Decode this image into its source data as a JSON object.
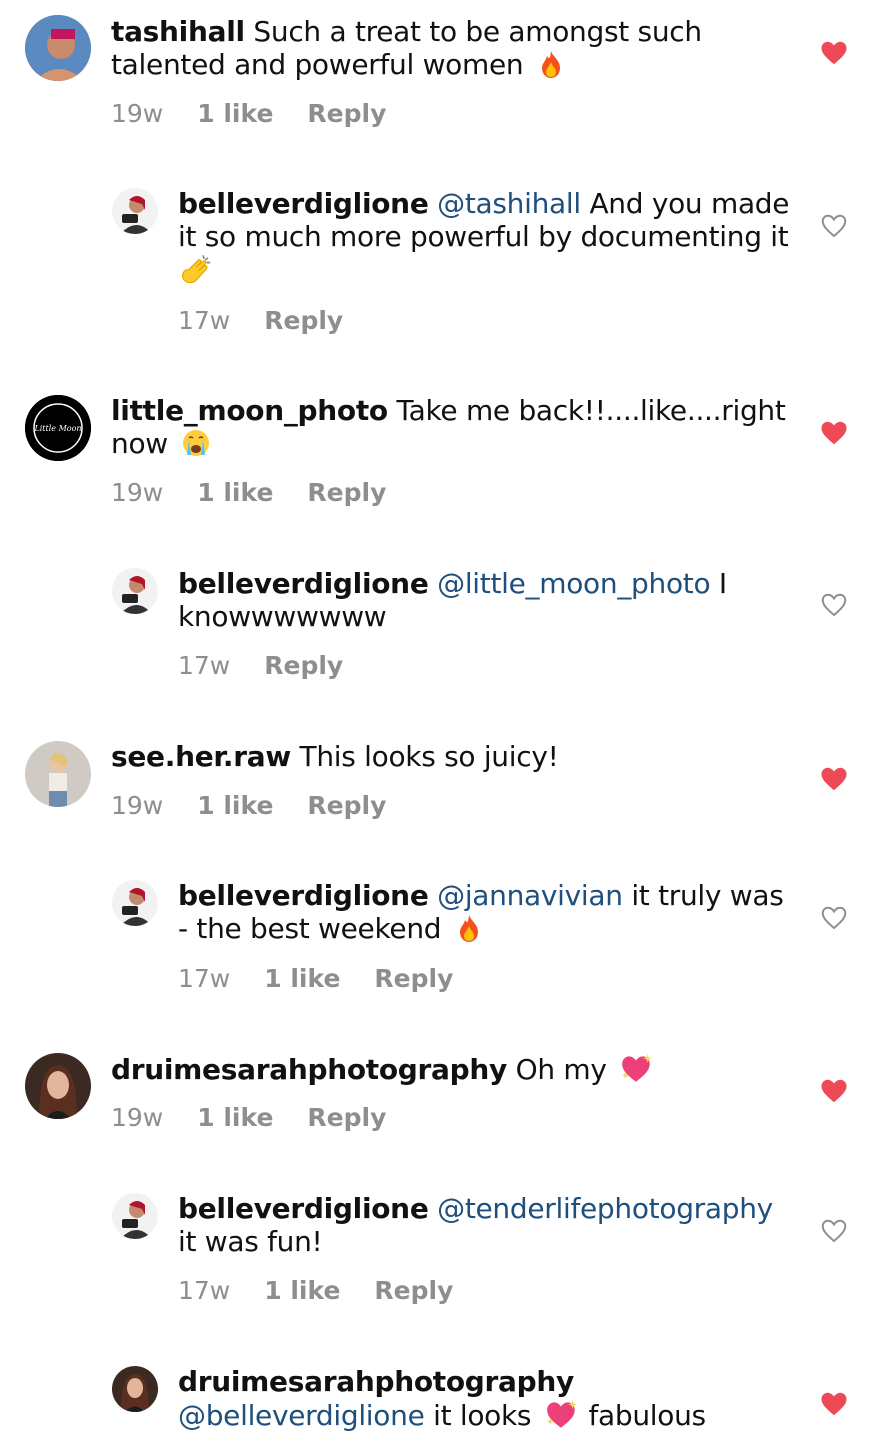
{
  "comments": [
    {
      "user": "tashihall",
      "text": "Such a treat to be amongst such talented and powerful women",
      "emoji": "fire-emoji",
      "age": "19w",
      "likes": "1 like",
      "reply": "Reply",
      "liked": true
    },
    {
      "user": "belleverdiglione",
      "mention": "@tashihall",
      "text": "And you made it so much more powerful by documenting it",
      "emoji": "clapping-hands-emoji",
      "age": "17w",
      "reply": "Reply",
      "liked": false
    },
    {
      "user": "little_moon_photo",
      "text": "Take me back!!....like....right now",
      "emoji": "crying-face-emoji",
      "age": "19w",
      "likes": "1 like",
      "reply": "Reply",
      "liked": true
    },
    {
      "user": "belleverdiglione",
      "mention": "@little_moon_photo",
      "text": "I knowwwwwww",
      "age": "17w",
      "reply": "Reply",
      "liked": false
    },
    {
      "user": "see.her.raw",
      "text": "This looks so juicy!",
      "age": "19w",
      "likes": "1 like",
      "reply": "Reply",
      "liked": true
    },
    {
      "user": "belleverdiglione",
      "mention": "@jannavivian",
      "text": "it truly was - the best weekend",
      "emoji": "fire-emoji",
      "age": "17w",
      "likes": "1 like",
      "reply": "Reply",
      "liked": false
    },
    {
      "user": "druimesarahphotography",
      "text": "Oh my",
      "emoji": "sparkling-heart-emoji",
      "age": "19w",
      "likes": "1 like",
      "reply": "Reply",
      "liked": true
    },
    {
      "user": "belleverdiglione",
      "mention": "@tenderlifephotography",
      "text": "it was fun!",
      "age": "17w",
      "likes": "1 like",
      "reply": "Reply",
      "liked": false
    },
    {
      "user": "druimesarahphotography",
      "mention": "@belleverdiglione",
      "text": "it looks",
      "text2": "fabulous",
      "emoji": "sparkling-heart-emoji",
      "liked": true
    }
  ],
  "colors": {
    "heart_liked": "#ed4956",
    "heart_outline": "#8e8e8e",
    "mention": "#1f4f7c",
    "meta": "#8e8e8e"
  }
}
